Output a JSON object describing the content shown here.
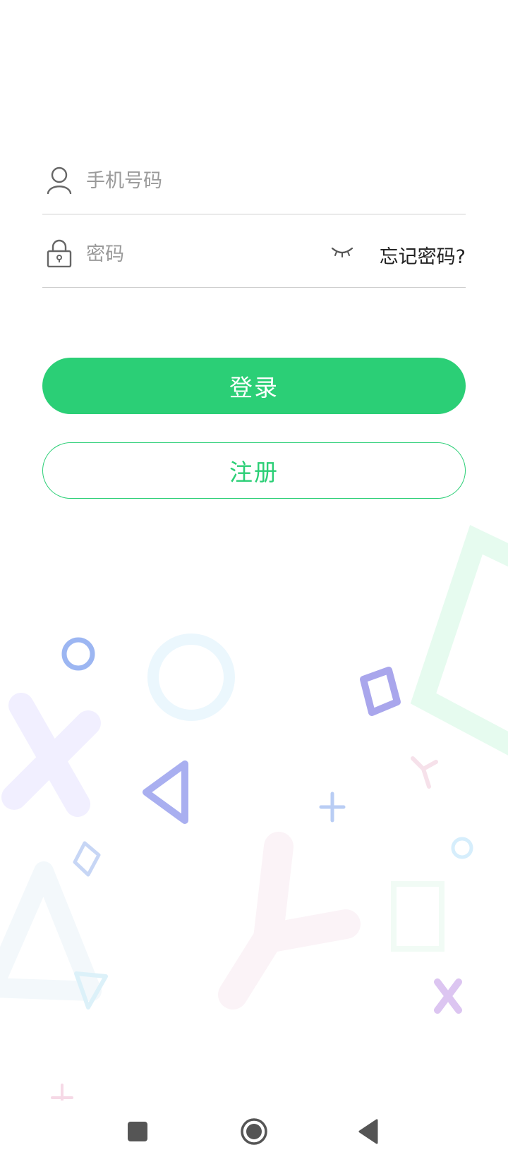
{
  "login_form": {
    "phone": {
      "icon": "user-icon",
      "placeholder": "手机号码",
      "value": ""
    },
    "password": {
      "icon": "lock-icon",
      "placeholder": "密码",
      "value": "",
      "toggle_icon": "eye-closed-icon",
      "forgot_label": "忘记密码?"
    },
    "login_label": "登录",
    "register_label": "注册"
  },
  "colors": {
    "accent": "#2bcf76",
    "button_text": "#ffffff",
    "background": "#ffffff",
    "divider": "#cfcfcf"
  },
  "system_nav": {
    "recent_icon": "square-icon",
    "home_icon": "circle-home-icon",
    "back_icon": "triangle-back-icon"
  }
}
